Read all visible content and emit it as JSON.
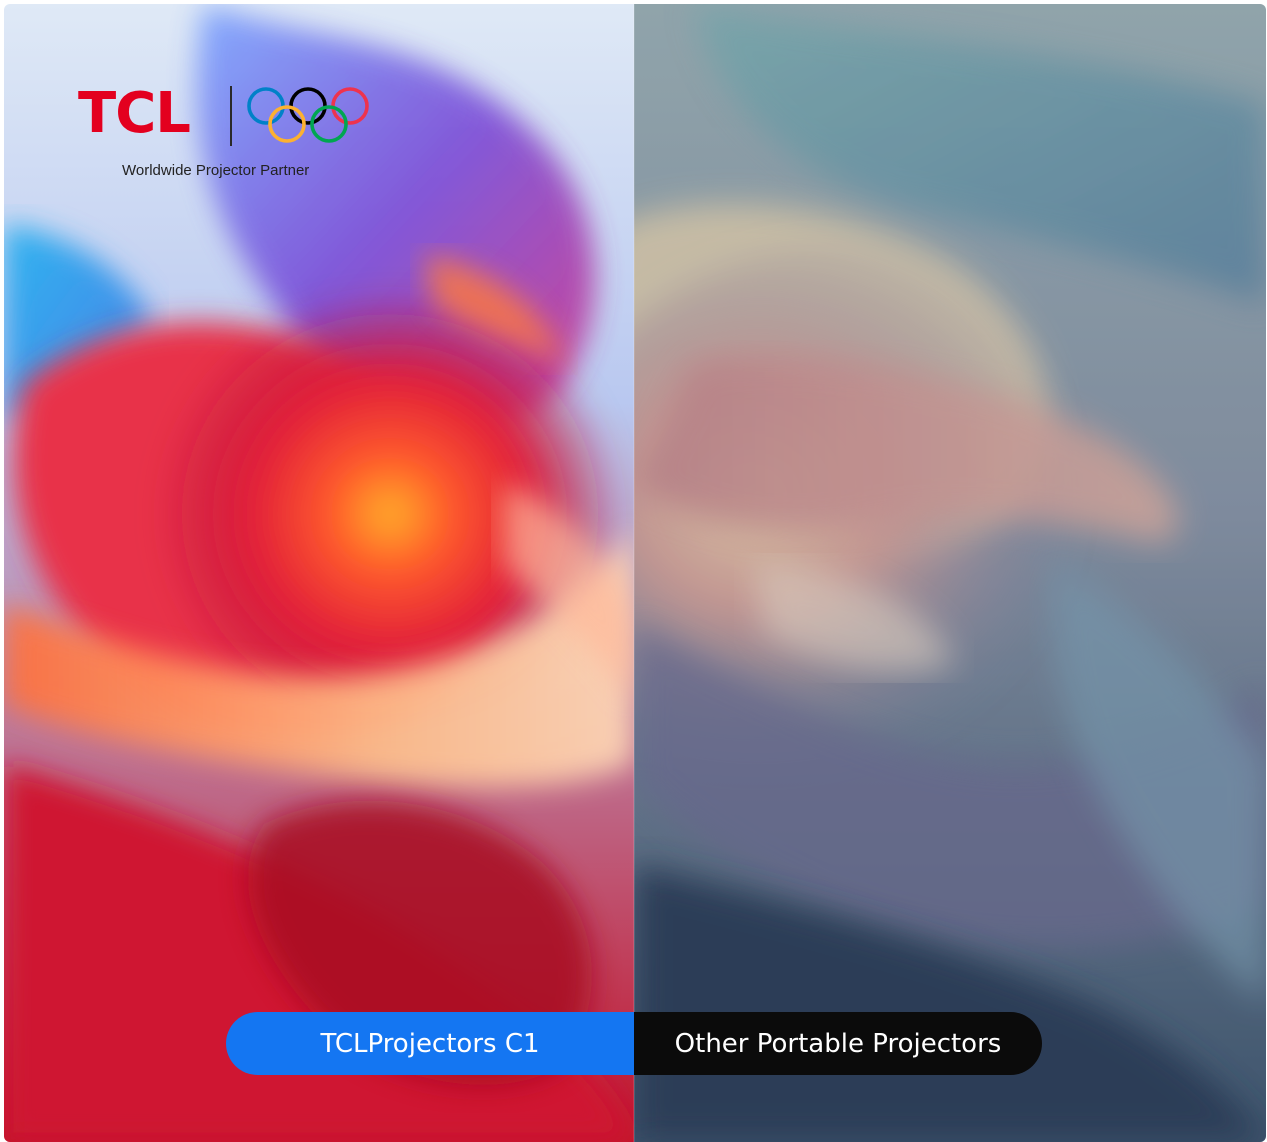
{
  "brand": {
    "wordmark": "TCL",
    "tagline": "Worldwide Projector Partner",
    "brand_color": "#e3001f",
    "partner_mark": "olympic-rings-icon",
    "ring_colors": [
      "#0081c8",
      "#fcb131",
      "#000000",
      "#00a651",
      "#ee334e"
    ]
  },
  "comparison": {
    "left_label": "TCLProjectors C1",
    "right_label": "Other Portable Projectors",
    "left_color": "#1476f2",
    "right_color": "#0b0b0b"
  }
}
